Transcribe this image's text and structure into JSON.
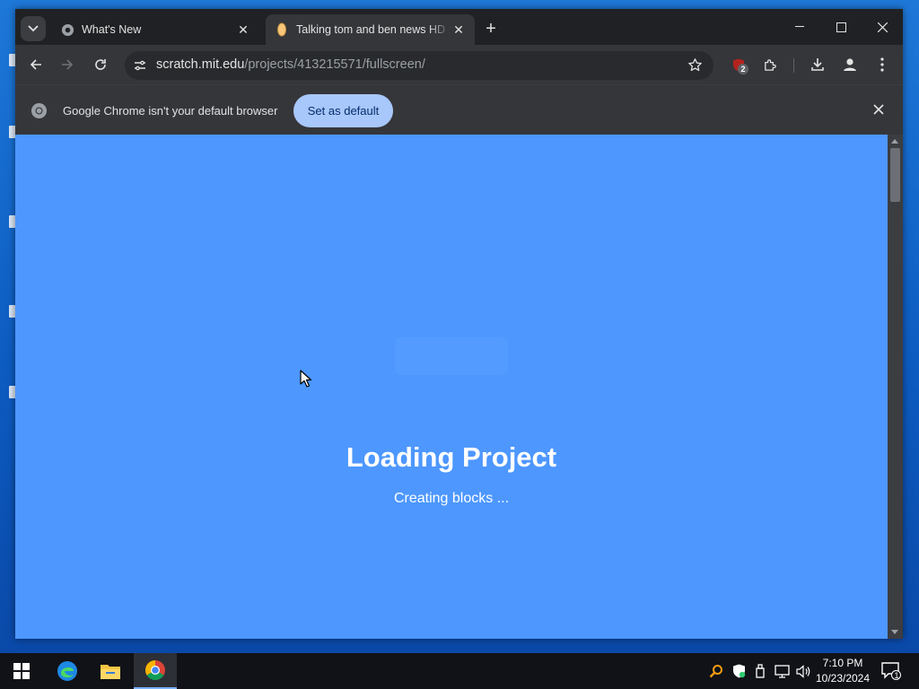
{
  "browser": {
    "tabs": [
      {
        "title": "What's New",
        "active": false
      },
      {
        "title": "Talking tom and ben news HD :",
        "active": true
      }
    ],
    "address": {
      "host": "scratch.mit.edu",
      "path": "/projects/413215571/fullscreen/"
    },
    "extension_badge": "2",
    "infobar": {
      "message": "Google Chrome isn't your default browser",
      "button_label": "Set as default"
    }
  },
  "page": {
    "title": "Loading Project",
    "status": "Creating blocks ...",
    "background_color": "#4d97ff"
  },
  "taskbar": {
    "apps": [
      "windows-start",
      "edge",
      "file-explorer",
      "chrome"
    ],
    "clock": {
      "time": "7:10 PM",
      "date": "10/23/2024"
    },
    "notification_count": "1"
  }
}
